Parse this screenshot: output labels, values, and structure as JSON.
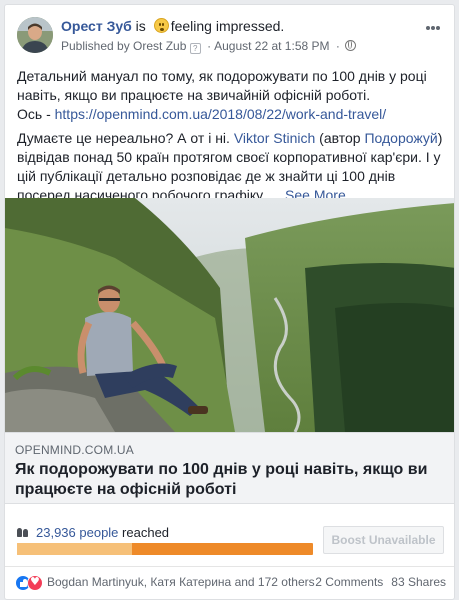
{
  "post": {
    "author": "Орест Зуб",
    "is_word": "is",
    "feeling": "feeling impressed.",
    "published_by": "Published by Orest Zub",
    "qbox": "?",
    "date": "August 22 at 1:58 PM",
    "dot": "·",
    "text1": "Детальний мануал по тому, як подорожувати по 100 днів у році навіть, якщо ви працюєте на звичайній офісній роботі.",
    "text2_prefix": "Ось - ",
    "text2_link": "https://openmind.com.ua/2018/08/22/work-and-travel/",
    "text3_a": "Думаєте це нереально? А от і ні. ",
    "text3_name": "Viktor Stinich",
    "text3_b": " (автор ",
    "text3_page": "Подорожуй",
    "text3_c": ") відвідав понад 50 країн протягом своєї корпоративної кар'єри. І у цій публікації детально розповідає де ж знайти ці 100 днів посеред насиченого робочого графіку. ... ",
    "see_more": "See More"
  },
  "link_preview": {
    "domain": "OPENMIND.COM.UA",
    "title": "Як подорожувати по 100 днів у році навіть, якщо ви працюєте на офісній роботі"
  },
  "insights": {
    "reach_count": "23,936 people",
    "reach_label": "reached",
    "organic_fraction": 0.39,
    "boost_label": "Boost Unavailable"
  },
  "reactions": {
    "names": "Bogdan Martinyuk, Катя Катерина and 172 others",
    "comments": "2 Comments",
    "shares": "83 Shares"
  },
  "colors": {
    "link": "#365899",
    "organic": "#f6c078",
    "paid": "#ee8a29",
    "like": "#1877f2",
    "love": "#f33e58"
  }
}
